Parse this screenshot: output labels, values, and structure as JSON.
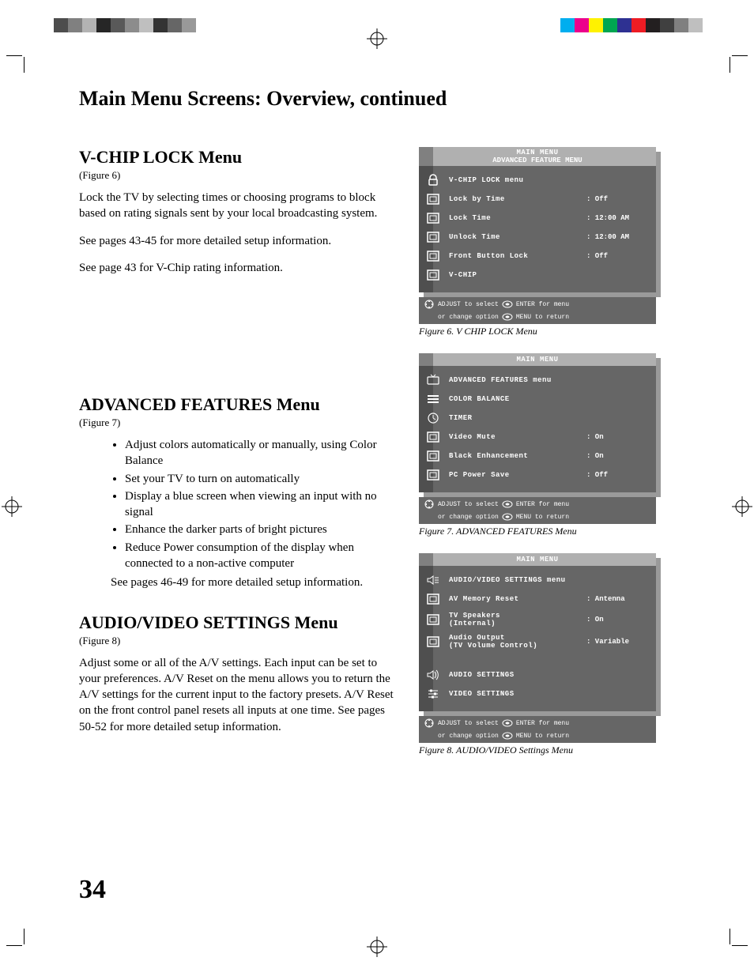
{
  "page": {
    "title": "Main Menu Screens: Overview, continued",
    "number": "34"
  },
  "sections": {
    "vchip": {
      "title": "V-CHIP LOCK Menu",
      "figref": "(Figure 6)",
      "p1": "Lock the TV by selecting times or choosing programs to block based on rating signals sent by your local broadcasting system.",
      "p2": "See pages 43-45 for more detailed setup information.",
      "p3": "See page 43 for V-Chip rating information."
    },
    "adv": {
      "title": "ADVANCED FEATURES Menu",
      "figref": "(Figure 7)",
      "bullets": [
        "Adjust colors automatically or manually, using Color Balance",
        "Set your TV to turn on automatically",
        "Display a blue screen when viewing an input with no signal",
        "Enhance the darker parts of bright pictures",
        "Reduce Power consumption of the display when connected to a non-active computer"
      ],
      "tail": "See pages 46-49 for more detailed setup information."
    },
    "av": {
      "title": "AUDIO/VIDEO SETTINGS Menu",
      "figref": "(Figure 8)",
      "p1": "Adjust some or all of the A/V settings.  Each input can be set to your preferences.  A/V Reset on the menu allows you to return the A/V settings for the current input to the factory presets.  A/V Reset on the front control panel resets all inputs at one time.  See pages 50-52 for more detailed setup information."
    }
  },
  "osd_common": {
    "main_menu": "MAIN MENU",
    "hint_adjust": "ADJUST to select",
    "hint_enter": "ENTER for menu",
    "hint_change": "or change option",
    "hint_menu": "MENU to return"
  },
  "fig6": {
    "subtitle": "ADVANCED FEATURE MENU",
    "caption": "Figure 6.  V CHIP LOCK Menu",
    "rows": [
      {
        "label": "V-CHIP LOCK menu",
        "val": ""
      },
      {
        "label": "Lock by Time",
        "val": ": Off"
      },
      {
        "label": "Lock Time",
        "val": ": 12:00 AM"
      },
      {
        "label": "Unlock Time",
        "val": ": 12:00 AM"
      },
      {
        "label": "Front Button Lock",
        "val": ": Off"
      },
      {
        "label": "V-CHIP",
        "val": ""
      }
    ]
  },
  "fig7": {
    "caption": "Figure 7.  ADVANCED FEATURES Menu",
    "rows": [
      {
        "label": "ADVANCED FEATURES menu",
        "val": ""
      },
      {
        "label": "COLOR BALANCE",
        "val": ""
      },
      {
        "label": "TIMER",
        "val": ""
      },
      {
        "label": "Video Mute",
        "val": ": On"
      },
      {
        "label": "Black Enhancement",
        "val": ": On"
      },
      {
        "label": "PC Power Save",
        "val": ": Off"
      }
    ]
  },
  "fig8": {
    "caption": "Figure 8.  AUDIO/VIDEO Settings Menu",
    "rows": [
      {
        "label": "AUDIO/VIDEO SETTINGS menu",
        "val": ""
      },
      {
        "label": "AV Memory Reset",
        "val": ": Antenna"
      },
      {
        "label": "TV Speakers\n(Internal)",
        "val": ": On"
      },
      {
        "label": "Audio Output\n(TV Volume Control)",
        "val": ": Variable"
      },
      {
        "label": "AUDIO SETTINGS",
        "val": ""
      },
      {
        "label": "VIDEO SETTINGS",
        "val": ""
      }
    ]
  },
  "swatches_left": [
    "#4d4d4d",
    "#808080",
    "#b3b3b3",
    "#262626",
    "#595959",
    "#8c8c8c",
    "#bfbfbf",
    "#333333",
    "#666666",
    "#999999"
  ],
  "swatches_right": [
    "#00aeef",
    "#ec008c",
    "#fff200",
    "#00a651",
    "#2e3192",
    "#ed1c24",
    "#231f20",
    "#404040",
    "#808080",
    "#bfbfbf"
  ]
}
